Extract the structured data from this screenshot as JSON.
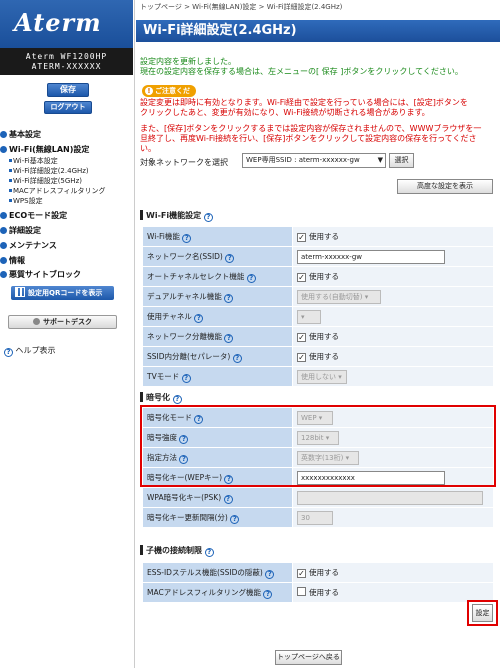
{
  "sidebar": {
    "logo": "Aterm",
    "model_line1": "Aterm WF1200HP",
    "model_line2": "ATERM-XXXXXX",
    "save_button": "保存",
    "logout_button": "ログアウト",
    "menu": {
      "basic": "基本設定",
      "wifi_lan": "Wi-Fi(無線LAN)設定",
      "wifi_basic": "Wi-Fi基本設定",
      "wifi_detail_24": "Wi-Fi詳細設定(2.4GHz)",
      "wifi_detail_5": "Wi-Fi詳細設定(5GHz)",
      "mac_filter": "MACアドレスフィルタリング",
      "wps": "WPS設定",
      "eco": "ECOモード設定",
      "detail": "詳細設定",
      "maintenance": "メンテナンス",
      "info": "情報",
      "malicious_block": "悪質サイトブロック"
    },
    "qr_button": "設定用QRコードを表示",
    "support_button": "サポートデスク",
    "help": "ヘルプ表示"
  },
  "breadcrumb": "トップページ > Wi-Fi(無線LAN)設定 > Wi-Fi詳細設定(2.4GHz)",
  "page_title": "Wi-Fi詳細設定(2.4GHz)",
  "messages": {
    "updated": "設定内容を更新しました。",
    "save_hint": "現在の設定内容を保存する場合は、左メニューの[ 保存 ]ボタンをクリックしてください。",
    "note_label": "ご注意ください",
    "warn1a": "設定変更は即時に有効となります。Wi-Fi経由で設定を行っている場合には、[設定]ボタンを",
    "warn1b": "クリックしたあと、変更が有効になり、Wi-Fi接続が切断される場合があります。",
    "warn2a": "また、[保存]ボタンをクリックするまでは設定内容が保存されませんので、WWWブラウザを一",
    "warn2b": "旦終了し、再度Wi-Fi接続を行い、[保存]ボタンをクリックして設定内容の保存を行ってくださ",
    "warn2c": "い。"
  },
  "network_select": {
    "label": "対象ネットワークを選択",
    "value": "WEP専用SSID : aterm-xxxxxx-gw",
    "select_button": "選択",
    "advanced_button": "高度な設定を表示"
  },
  "wifi_section": {
    "title": "Wi-Fi機能設定",
    "rows": {
      "wifi_func": {
        "label": "Wi-Fi機能",
        "check": "使用する"
      },
      "ssid": {
        "label": "ネットワーク名(SSID)",
        "value": "aterm-xxxxxx-gw"
      },
      "auto_channel": {
        "label": "オートチャネルセレクト機能",
        "check": "使用する"
      },
      "dual_channel": {
        "label": "デュアルチャネル機能",
        "value": "使用する(自動切替)"
      },
      "channel": {
        "label": "使用チャネル",
        "value": ""
      },
      "net_separation": {
        "label": "ネットワーク分離機能",
        "check": "使用する"
      },
      "ssid_separation": {
        "label": "SSID内分離(セパレータ)",
        "check": "使用する"
      },
      "tv_mode": {
        "label": "TVモード",
        "value": "使用しない"
      }
    }
  },
  "encryption_section": {
    "title": "暗号化",
    "rows": {
      "mode": {
        "label": "暗号化モード",
        "value": "WEP"
      },
      "strength": {
        "label": "暗号強度",
        "value": "128bit"
      },
      "method": {
        "label": "指定方法",
        "value": "英数字(13桁)"
      },
      "wep_key": {
        "label": "暗号化キー(WEPキー)",
        "value": "xxxxxxxxxxxxx"
      },
      "psk": {
        "label": "WPA暗号化キー(PSK)",
        "value": ""
      },
      "rekey": {
        "label": "暗号化キー更新間隔(分)",
        "value": "30"
      }
    }
  },
  "client_section": {
    "title": "子機の接続制限",
    "rows": {
      "stealth": {
        "label": "ESS-IDステルス機能(SSIDの隠蔽)",
        "check": "使用する",
        "checked": true
      },
      "mac_filter": {
        "label": "MACアドレスフィルタリング機能",
        "check": "使用する",
        "checked": false
      }
    }
  },
  "set_button": "設定",
  "top_button": "トップページへ戻る",
  "colors": {
    "brand_blue": "#1d58aa",
    "alert_red": "#d70000",
    "success_green": "#1a8a1a",
    "label_bg": "#c6d9ef"
  }
}
